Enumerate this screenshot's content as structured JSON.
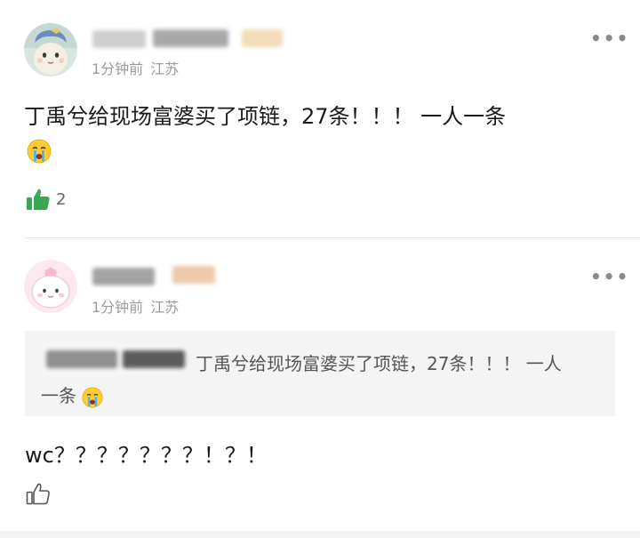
{
  "comments": [
    {
      "time": "1分钟前",
      "location": "江苏",
      "more_label": "•••",
      "text_line1": "丁禹兮给现场富婆买了项链，27条！！！ 一人一条",
      "emoji": "crying-face",
      "like_count": "2",
      "like_color": "#3aa757"
    },
    {
      "time": "1分钟前",
      "location": "江苏",
      "more_label": "•••",
      "quote_line1": "丁禹兮给现场富婆买了项链，27条！！！ 一人",
      "quote_line2": "一条",
      "quote_emoji": "crying-face",
      "text": "wc？？？？？？？！？！"
    }
  ]
}
